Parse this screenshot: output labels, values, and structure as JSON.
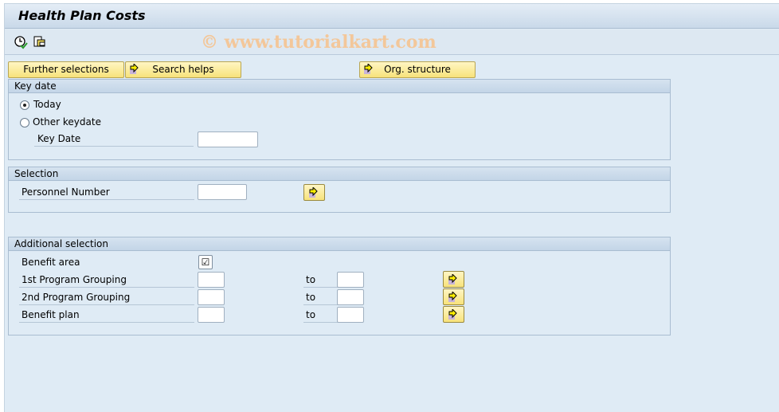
{
  "title": "Health Plan Costs",
  "watermark": "© www.tutorialkart.com",
  "toolbar": {
    "icons": [
      "execute-clock-icon",
      "get-variant-icon"
    ]
  },
  "buttons": {
    "further": "Further selections",
    "search": "Search helps",
    "org": "Org. structure"
  },
  "key_date": {
    "header": "Key date",
    "today": "Today",
    "other": "Other keydate",
    "key_date_label": "Key Date",
    "key_date_value": "",
    "selected": "today"
  },
  "selection": {
    "header": "Selection",
    "personnel": "Personnel Number",
    "personnel_value": ""
  },
  "additional": {
    "header": "Additional selection",
    "benefit_area": "Benefit area",
    "benefit_area_checked": true,
    "check_mark": "☑",
    "rows": [
      {
        "label": "1st Program Grouping",
        "to": "to"
      },
      {
        "label": "2nd Program Grouping",
        "to": "to"
      },
      {
        "label": "Benefit plan",
        "to": "to"
      }
    ]
  },
  "colors": {
    "button": "#f7e27a",
    "background": "#dfebf5"
  }
}
